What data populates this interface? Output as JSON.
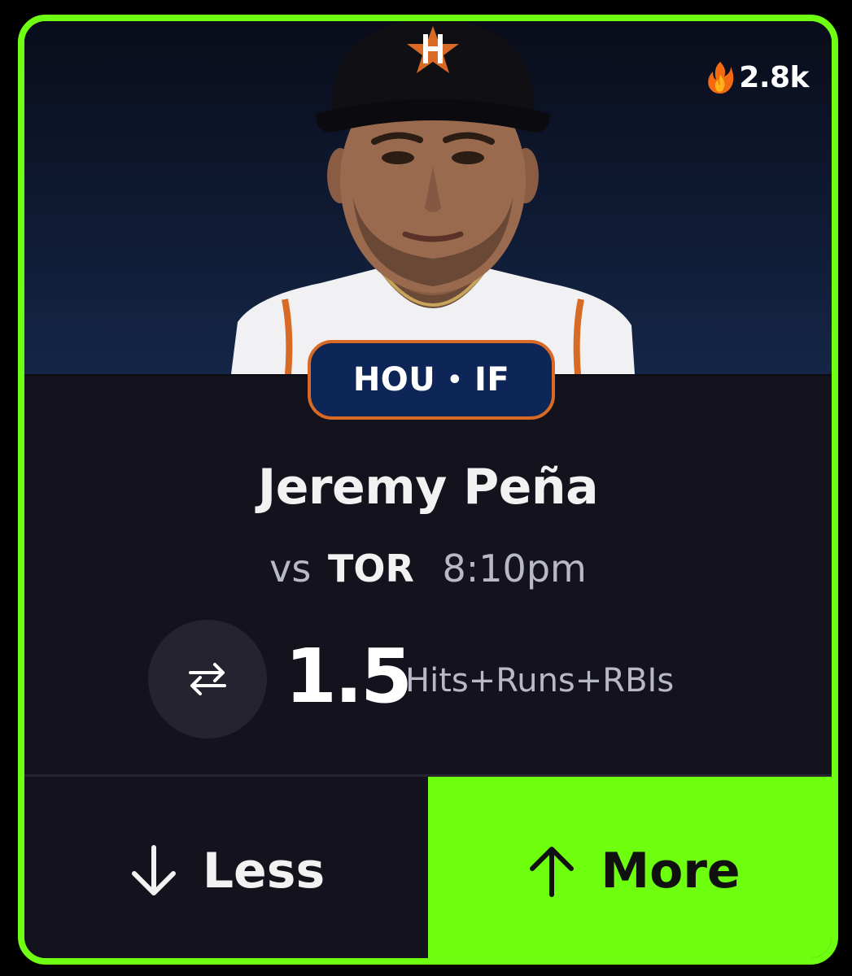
{
  "trend": {
    "icon": "fire-icon",
    "value": "2.8k"
  },
  "player": {
    "team_code": "HOU",
    "separator": "•",
    "position": "IF",
    "name": "Jeremy Peña",
    "cap_logo": "H"
  },
  "matchup": {
    "vs_label": "vs",
    "opponent": "TOR",
    "time": "8:10pm"
  },
  "projection": {
    "line": "1.5",
    "stat": "Hits+Runs+RBIs",
    "swap_icon": "swap-arrows-icon"
  },
  "actions": {
    "less_label": "Less",
    "less_icon": "arrow-down-icon",
    "more_label": "More",
    "more_icon": "arrow-up-icon"
  },
  "colors": {
    "accent": "#6dff0e",
    "card_bg": "#14131d",
    "badge_bg": "#0e2657",
    "badge_border": "#d86a25"
  }
}
